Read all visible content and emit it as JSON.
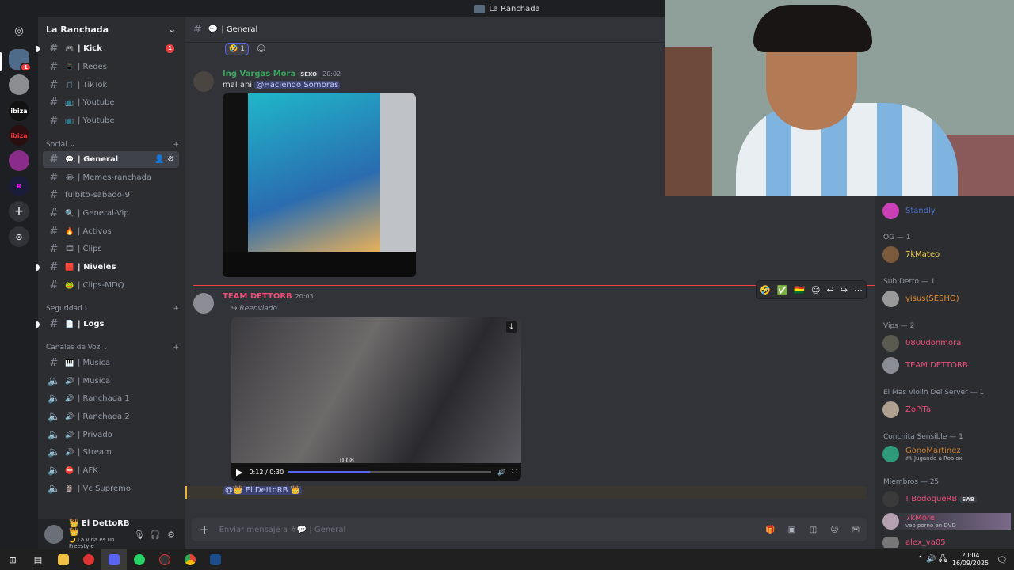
{
  "window": {
    "title": "La Ranchada"
  },
  "server": {
    "name": "La Ranchada"
  },
  "channels": [
    {
      "label": "| Kick",
      "emoji": "🎮",
      "bold": true,
      "badge": "1"
    },
    {
      "label": "| Redes",
      "emoji": "📱"
    },
    {
      "label": "| TikTok",
      "emoji": "🎵"
    },
    {
      "label": "| Youtube",
      "emoji": "📺"
    },
    {
      "label": "| Youtube",
      "emoji": "📺"
    },
    {
      "label": "| General",
      "emoji": "💬",
      "active": true
    },
    {
      "label": "| Memes-ranchada",
      "emoji": "😂"
    },
    {
      "label": "fulbito-sabado-9",
      "emoji": ""
    },
    {
      "label": "| General-Vip",
      "emoji": "🔍"
    },
    {
      "label": "| Activos",
      "emoji": "🔥"
    },
    {
      "label": "| Clips",
      "emoji": "🎞"
    },
    {
      "label": "| Niveles",
      "emoji": "🟥",
      "bold": true
    },
    {
      "label": "| Clips-MDQ",
      "emoji": "🐸"
    },
    {
      "label": "| Logs",
      "emoji": "📄",
      "bold": true
    },
    {
      "label": "| Musica",
      "emoji": "🎹"
    },
    {
      "label": "| Musica",
      "emoji": "🔊",
      "voice": true
    },
    {
      "label": "| Ranchada 1",
      "emoji": "🔊",
      "voice": true
    },
    {
      "label": "| Ranchada 2",
      "emoji": "🔊",
      "voice": true
    },
    {
      "label": "| Privado",
      "emoji": "🔊",
      "voice": true
    },
    {
      "label": "| Stream",
      "emoji": "🔊",
      "voice": true
    },
    {
      "label": "| AFK",
      "emoji": "⛔",
      "voice": true
    },
    {
      "label": "| Vc Supremo",
      "emoji": "🗿",
      "voice": true
    }
  ],
  "categories": {
    "social": "Social",
    "seguridad": "Seguridad",
    "voz": "Canales de Voz"
  },
  "user": {
    "name": "👑 El DettoRB 👑",
    "status": "🌙 La vida es un Freestyle"
  },
  "chat": {
    "channel_name": "| General",
    "reaction_count": "1",
    "msg1": {
      "author": "Ing Vargas Mora",
      "tag": "SEXO",
      "time": "20:02",
      "text": "mal ahi",
      "mention": "@Haciendo Sombras"
    },
    "msg2": {
      "author": "TEAM DETTORB",
      "time": "20:03",
      "forwarded": "Reenviado"
    },
    "video": {
      "time": "0:12 / 0:30",
      "hover_time": "0:08",
      "progress": 0.4
    },
    "reply_mention": "@👑 El DettoRB 👑",
    "input_placeholder": "Enviar mensaje a #💬 | General"
  },
  "members": {
    "top_name": "Standly",
    "groups": [
      {
        "header": "OG — 1",
        "members": [
          {
            "name": "7kMateo",
            "color": "#f0d24a"
          }
        ]
      },
      {
        "header": "Sub Detto — 1",
        "members": [
          {
            "name": "yisus(SESHO)",
            "color": "#e58a2e"
          }
        ]
      },
      {
        "header": "Vips — 2",
        "members": [
          {
            "name": "0800donmora",
            "color": "#eb4f7a"
          },
          {
            "name": "TEAM DETTORB",
            "color": "#eb4f7a"
          }
        ]
      },
      {
        "header": "El Mas Violin Del Server — 1",
        "members": [
          {
            "name": "ZoPiTa",
            "color": "#eb4f7a"
          }
        ]
      },
      {
        "header": "Conchita Sensible — 1",
        "members": [
          {
            "name": "GonoMartinez",
            "color": "#c87f2f",
            "status": "🎮 Jugando a Roblox"
          }
        ]
      },
      {
        "header": "Miembros — 25",
        "members": [
          {
            "name": "! BodoqueRB",
            "color": "#eb4f7a",
            "tag": "SAB"
          },
          {
            "name": "7kMore",
            "color": "#eb4f7a",
            "status": "veo porno en DVD"
          },
          {
            "name": "alex_va05",
            "color": "#eb4f7a"
          }
        ]
      }
    ]
  },
  "taskbar": {
    "time": "20:04",
    "date": "16/09/2025"
  }
}
